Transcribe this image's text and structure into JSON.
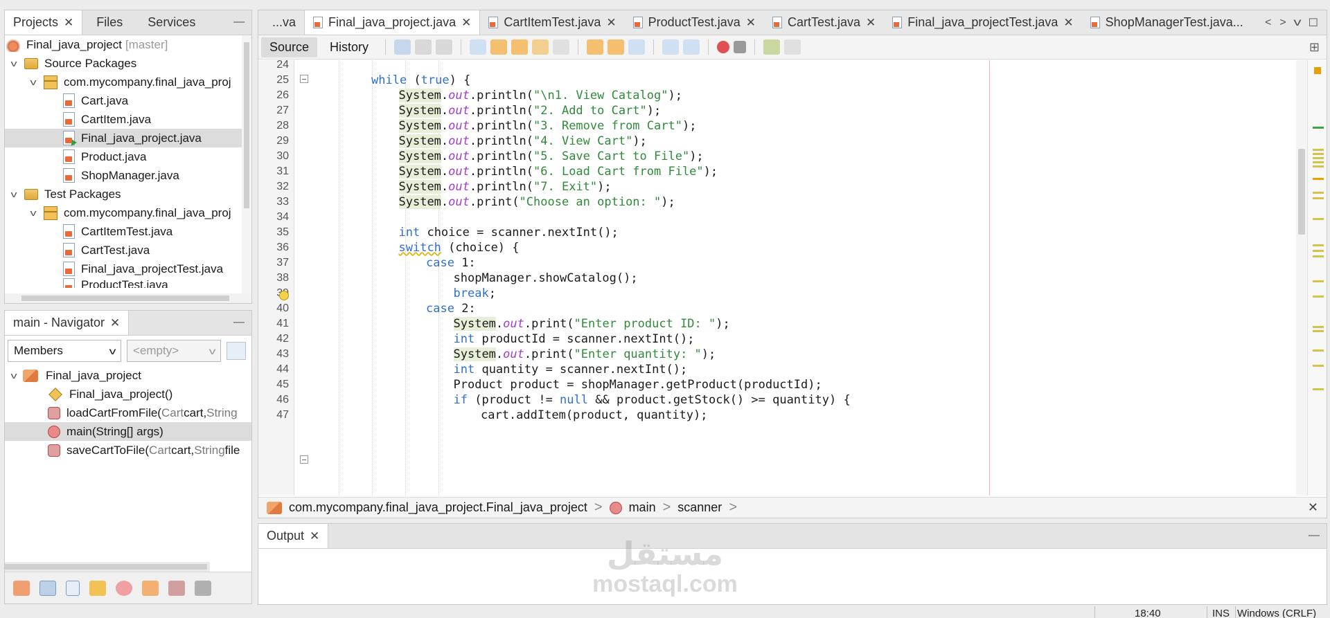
{
  "projects_panel": {
    "tabs": [
      "Projects",
      "Files",
      "Services"
    ],
    "tree": [
      {
        "label": "Final_java_project",
        "suffix": "[master]"
      },
      {
        "label": "Source Packages"
      },
      {
        "label": "com.mycompany.final_java_proj"
      },
      {
        "label": "Cart.java"
      },
      {
        "label": "CartItem.java"
      },
      {
        "label": "Final_java_project.java"
      },
      {
        "label": "Product.java"
      },
      {
        "label": "ShopManager.java"
      },
      {
        "label": "Test Packages"
      },
      {
        "label": "com.mycompany.final_java_proj"
      },
      {
        "label": "CartItemTest.java"
      },
      {
        "label": "CartTest.java"
      },
      {
        "label": "Final_java_projectTest.java"
      },
      {
        "label": "ProductTest.java"
      }
    ]
  },
  "navigator": {
    "title": "main - Navigator",
    "filter": "Members",
    "secondary": "<empty>",
    "items": [
      {
        "name": "Final_java_project"
      },
      {
        "name": "Final_java_project()"
      },
      {
        "name": "loadCartFromFile(",
        "type": "Cart",
        "rest": " cart, ",
        "type2": "String"
      },
      {
        "name": "main(String[] args)"
      },
      {
        "name": "saveCartToFile(",
        "type": "Cart",
        "rest": " cart, ",
        "type2": "String",
        "tail": " file"
      }
    ]
  },
  "editor": {
    "tabs": [
      "...va",
      "Final_java_project.java",
      "CartItemTest.java",
      "ProductTest.java",
      "CartTest.java",
      "Final_java_projectTest.java",
      "ShopManagerTest.java..."
    ],
    "toolbar": {
      "source": "Source",
      "history": "History"
    },
    "lines": [
      {
        "n": "24"
      },
      {
        "n": "25",
        "code": "while (true) {"
      },
      {
        "n": "26",
        "pre": "System",
        "mid": "out",
        "post": ".println(",
        "str": "\"\\n1. View Catalog\"",
        "end": ");"
      },
      {
        "n": "27",
        "pre": "System",
        "mid": "out",
        "post": ".println(",
        "str": "\"2. Add to Cart\"",
        "end": ");"
      },
      {
        "n": "28",
        "pre": "System",
        "mid": "out",
        "post": ".println(",
        "str": "\"3. Remove from Cart\"",
        "end": ");"
      },
      {
        "n": "29",
        "pre": "System",
        "mid": "out",
        "post": ".println(",
        "str": "\"4. View Cart\"",
        "end": ");"
      },
      {
        "n": "30",
        "pre": "System",
        "mid": "out",
        "post": ".println(",
        "str": "\"5. Save Cart to File\"",
        "end": ");"
      },
      {
        "n": "31",
        "pre": "System",
        "mid": "out",
        "post": ".println(",
        "str": "\"6. Load Cart from File\"",
        "end": ");"
      },
      {
        "n": "32",
        "pre": "System",
        "mid": "out",
        "post": ".println(",
        "str": "\"7. Exit\"",
        "end": ");"
      },
      {
        "n": "33",
        "pre": "System",
        "mid": "out",
        "post": ".print(",
        "str": "\"Choose an option: \"",
        "end": ");"
      },
      {
        "n": "34"
      },
      {
        "n": "35",
        "kw": "int",
        "code": " choice = scanner.nextInt();"
      },
      {
        "n": "36",
        "kw": "switch",
        "code": " (choice) {"
      },
      {
        "n": "37",
        "kw": "case",
        "code": " 1:"
      },
      {
        "n": "38",
        "code": "shopManager.showCatalog();"
      },
      {
        "n": "39",
        "kw": "break",
        "code": ";"
      },
      {
        "n": "40",
        "kw": "case",
        "code": " 2:"
      },
      {
        "n": "41",
        "pre": "System",
        "mid": "out",
        "post": ".print(",
        "str": "\"Enter product ID: \"",
        "end": ");"
      },
      {
        "n": "42",
        "kw": "int",
        "code": " productId = scanner.nextInt();"
      },
      {
        "n": "43",
        "pre": "System",
        "mid": "out",
        "post": ".print(",
        "str": "\"Enter quantity: \"",
        "end": ");"
      },
      {
        "n": "44",
        "kw": "int",
        "code": " quantity = scanner.nextInt();"
      },
      {
        "n": "45",
        "code": "Product product = shopManager.getProduct(productId);"
      },
      {
        "n": "46",
        "kw": "if",
        "code": " (product != ",
        "kw2": "null",
        "code2": " && product.getStock() >= quantity) {"
      },
      {
        "n": "47",
        "code": "cart.addItem(product, quantity);"
      }
    ],
    "breadcrumb": [
      "com.mycompany.final_java_project.Final_java_project",
      "main",
      "scanner"
    ]
  },
  "output": {
    "tab": "Output"
  },
  "status": {
    "time": "18:40",
    "mode": "INS",
    "line_ending": "Windows (CRLF)"
  },
  "watermark": {
    "logo": "مستقل",
    "text": "mostaql.com"
  },
  "colors": {
    "keyword": "#2e6fd0",
    "string": "#2f8a3a",
    "field": "#a23bd0",
    "highlight": "#e6efd8"
  }
}
